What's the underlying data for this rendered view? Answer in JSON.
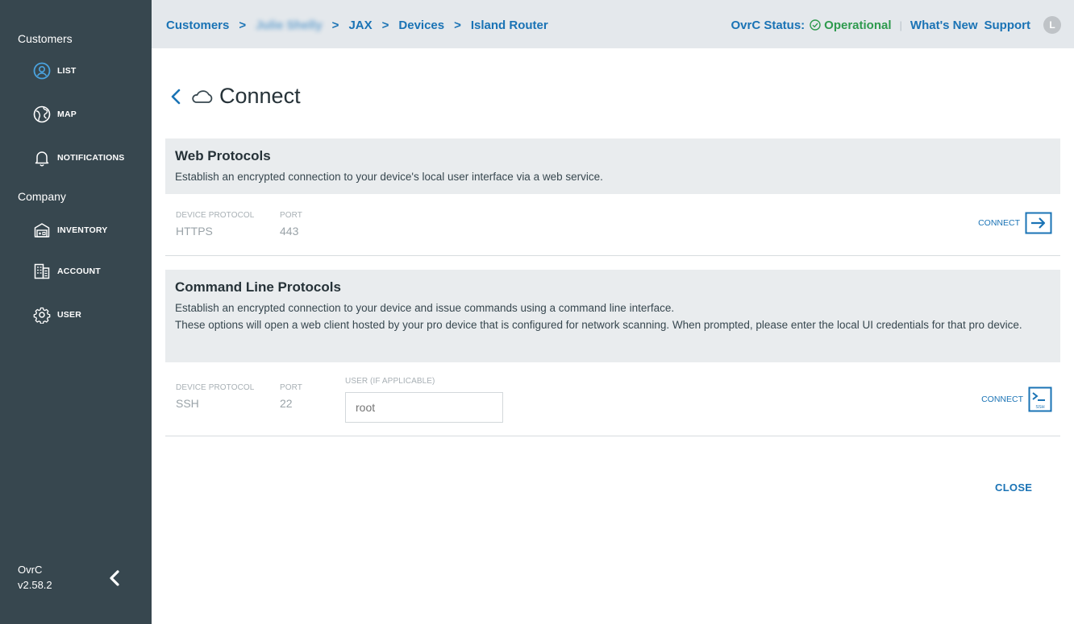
{
  "sidebar": {
    "customers_heading": "Customers",
    "company_heading": "Company",
    "items": [
      {
        "label": "LIST",
        "icon": "user-circle-icon"
      },
      {
        "label": "MAP",
        "icon": "globe-icon"
      },
      {
        "label": "NOTIFICATIONS",
        "icon": "bell-icon"
      },
      {
        "label": "INVENTORY",
        "icon": "inventory-box-icon"
      },
      {
        "label": "ACCOUNT",
        "icon": "building-icon"
      },
      {
        "label": "USER",
        "icon": "gear-icon"
      }
    ],
    "app_name": "OvrC",
    "version": "v2.58.2"
  },
  "header": {
    "breadcrumbs": [
      "Customers",
      "Julie Shelly",
      "JAX",
      "Devices",
      "Island Router"
    ],
    "status_label": "OvrC Status:",
    "status_value": "Operational",
    "whats_new": "What's New",
    "support": "Support",
    "avatar_initial": "L"
  },
  "page": {
    "title": "Connect"
  },
  "web_protocols": {
    "title": "Web Protocols",
    "description": "Establish an encrypted connection to your device's local user interface via a web service.",
    "device_protocol_label": "DEVICE PROTOCOL",
    "device_protocol_value": "HTTPS",
    "port_label": "PORT",
    "port_value": "443",
    "connect_label": "CONNECT"
  },
  "cli_protocols": {
    "title": "Command Line Protocols",
    "description_line1": "Establish an encrypted connection to your device and issue commands using a command line interface.",
    "description_line2": "These options will open a web client hosted by your pro device that is configured for network scanning. When prompted, please enter the local UI credentials for that pro device.",
    "device_protocol_label": "DEVICE PROTOCOL",
    "device_protocol_value": "SSH",
    "port_label": "PORT",
    "port_value": "22",
    "user_label": "USER (IF APPLICABLE)",
    "user_placeholder": "root",
    "connect_label": "CONNECT",
    "ssh_icon_text": "SSH"
  },
  "footer": {
    "close_label": "CLOSE"
  },
  "colors": {
    "sidebar_bg": "#37474f",
    "accent_blue": "#1a73b5",
    "status_green": "#2e9a4e",
    "topbar_bg": "#e4e8ec"
  }
}
